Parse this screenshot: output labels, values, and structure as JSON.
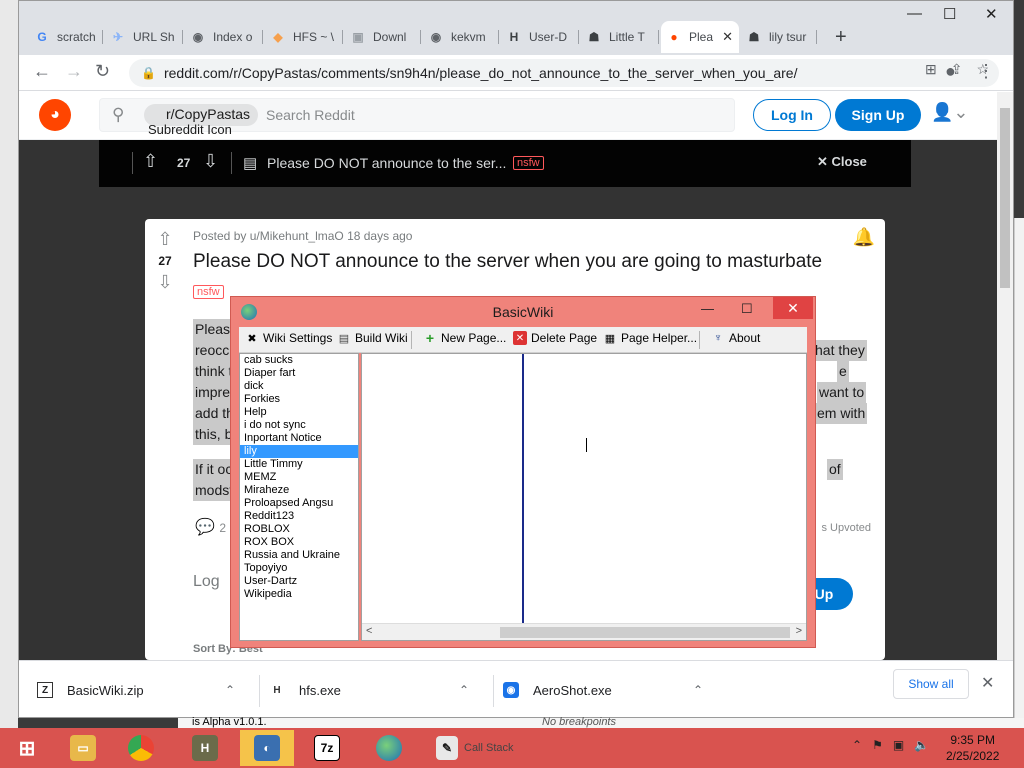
{
  "browser": {
    "tabs": [
      {
        "label": "scratch",
        "fav": "G",
        "color": "#4285f4"
      },
      {
        "label": "URL Sh",
        "fav": "✈",
        "color": "#8ab4f8"
      },
      {
        "label": "Index o",
        "fav": "◉",
        "color": "#5f6368"
      },
      {
        "label": "HFS ~ \\",
        "fav": "◆",
        "color": "#f6a04d"
      },
      {
        "label": "Downl",
        "fav": "▣",
        "color": "#9aa0a6"
      },
      {
        "label": "kekvm",
        "fav": "◉",
        "color": "#5f6368"
      },
      {
        "label": "User-D",
        "fav": "H",
        "color": "#3c4043"
      },
      {
        "label": "Little T",
        "fav": "☗",
        "color": "#3c4043"
      },
      {
        "label": "Plea",
        "fav": "●",
        "color": "#ff4500"
      },
      {
        "label": "lily tsur",
        "fav": "☗",
        "color": "#3c4043"
      }
    ],
    "url": "reddit.com/r/CopyPastas/comments/sn9h4n/please_do_not_announce_to_the_server_when_you_are/"
  },
  "reddit": {
    "chip": "r/CopyPastas",
    "chip_alt": "Subreddit Icon",
    "search_placeholder": "Search Reddit",
    "login": "Log In",
    "signup": "Sign Up",
    "postbar": {
      "votes": "27",
      "title": "Please DO NOT announce to the ser...",
      "nsfw": "nsfw",
      "close": "Close"
    },
    "post": {
      "meta": "Posted by u/Mikehunt_lmaO 18 days ago",
      "votes": "27",
      "title": "Please DO NOT announce to the server when you are going to masturbate",
      "nsfw": "nsfw",
      "para1_l1": "Please",
      "para1_l2": "reoccu",
      "para1_l3": "think t",
      "para1_l4": "impre",
      "para1_l5": "add th",
      "para1_l6": "this, b",
      "para1_r1": "hat they",
      "para1_r2": "e",
      "para1_r3": "want to",
      "para1_r4": "em with",
      "para2_l1": "If it oc",
      "para2_l2": "modst",
      "para2_r1": "of",
      "comments": "2",
      "upvoted": "s Upvoted",
      "log": "Log",
      "signup_short": "Up",
      "sortby": "Sort By: Best"
    }
  },
  "downloads": [
    {
      "name": "BasicWiki.zip",
      "icon": "zip-icon"
    },
    {
      "name": "hfs.exe",
      "icon": "hfs-icon"
    },
    {
      "name": "AeroShot.exe",
      "icon": "aeroshot-icon"
    }
  ],
  "show_all": "Show all",
  "behind": {
    "left": "is Alpha v1.0.1.",
    "right": "No breakpoints"
  },
  "basicwiki": {
    "title": "BasicWiki",
    "toolbar": [
      "Wiki Settings",
      "Build Wiki",
      "New Page...",
      "Delete Page",
      "Page Helper...",
      "About"
    ],
    "pages": [
      "cab sucks",
      "Diaper fart",
      "dick",
      "Forkies",
      "Help",
      "i do not sync",
      "Inportant Notice",
      "lily",
      "Little Timmy",
      "MEMZ",
      "Miraheze",
      "Proloapsed Angsu",
      "Reddit123",
      "ROBLOX",
      "ROX BOX",
      "Russia and Ukraine",
      "Topoyiyo",
      "User-Dartz",
      "Wikipedia"
    ],
    "selected": "lily"
  },
  "taskbar": {
    "callstack": "Call Stack",
    "time": "9:35 PM",
    "date": "2/25/2022"
  },
  "colors": {
    "reddit_orange": "#ff4500",
    "reddit_blue": "#0079d3",
    "taskbar": "#d9534f",
    "dialog": "#f0837b"
  }
}
